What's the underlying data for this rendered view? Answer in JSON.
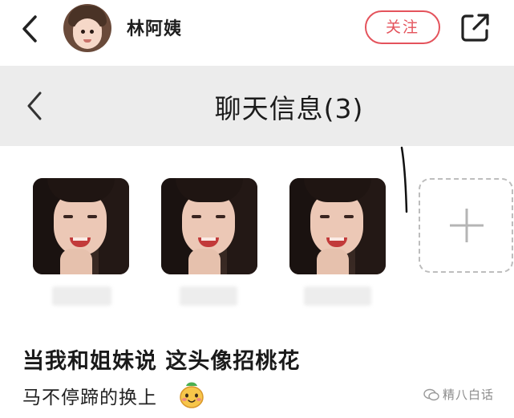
{
  "top_bar": {
    "username": "林阿姨",
    "follow_label": "关注",
    "back_icon": "chevron-left-icon",
    "share_icon": "share-icon"
  },
  "chat_header": {
    "title": "聊天信息(3)",
    "back_icon": "chevron-left-icon"
  },
  "members": {
    "items": [
      {
        "avatar": "member-avatar",
        "name_hidden": true
      },
      {
        "avatar": "member-avatar",
        "name_hidden": true
      },
      {
        "avatar": "member-avatar",
        "name_hidden": true
      }
    ],
    "add_icon": "plus-icon"
  },
  "caption": {
    "line1": "当我和姐妹说 这头像招桃花",
    "line2": "马不停蹄的换上",
    "emoji": "peach-face-emoji"
  },
  "watermark": {
    "text": "精八白话",
    "icon": "wechat-icon"
  },
  "colors": {
    "accent": "#e4535c",
    "header_bg": "#ececec"
  }
}
